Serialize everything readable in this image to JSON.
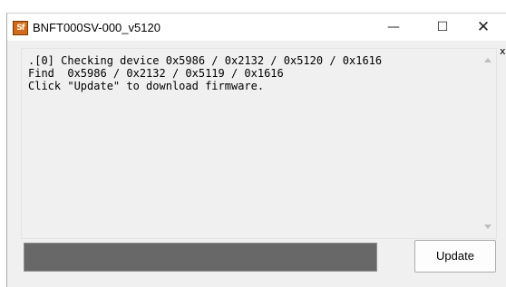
{
  "window": {
    "title": "BNFT000SV-000_v5120",
    "app_icon_text": "Sf",
    "minimize_glyph": "—",
    "maximize_glyph": "☐",
    "close_glyph": "✕"
  },
  "log": {
    "lines": ".[0] Checking device 0x5986 / 0x2132 / 0x5120 / 0x1616\nFind  0x5986 / 0x2132 / 0x5119 / 0x1616\nClick \"Update\" to download firmware."
  },
  "progress": {
    "value_percent": 0,
    "color": "#686868"
  },
  "buttons": {
    "update_label": "Update"
  },
  "edge_text": "x"
}
